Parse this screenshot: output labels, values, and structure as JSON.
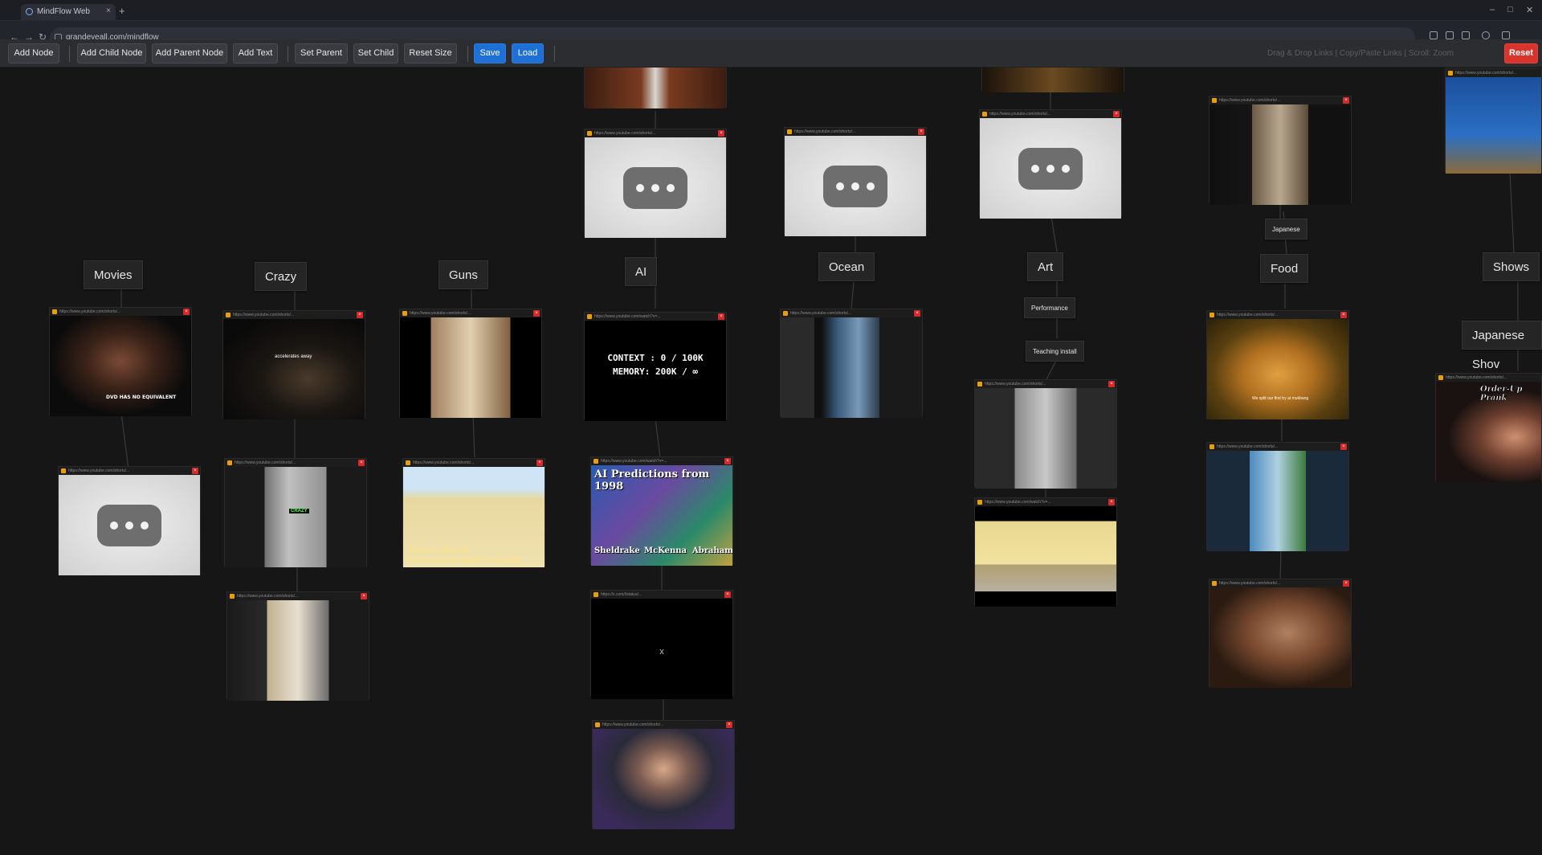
{
  "browser": {
    "tab_title": "MindFlow Web",
    "url": "grandeyeall.com/mindflow"
  },
  "toolbar": {
    "add_node": "Add Node",
    "add_child_node": "Add Child Node",
    "add_parent_node": "Add Parent Node",
    "add_text": "Add Text",
    "set_parent": "Set Parent",
    "set_child": "Set Child",
    "reset_size": "Reset Size",
    "save": "Save",
    "load": "Load",
    "reset": "Reset",
    "hint": "Drag & Drop Links | Copy/Paste Links | Scroll: Zoom"
  },
  "labels": {
    "movies": "Movies",
    "crazy": "Crazy",
    "guns": "Guns",
    "ai": "AI",
    "ocean": "Ocean",
    "art": "Art",
    "performance": "Performance",
    "teaching_install": "Teaching install",
    "food": "Food",
    "japanese": "Japanese",
    "shows": "Shows",
    "japanese_shows": "Japanese Shov"
  },
  "cards": {
    "ai_context": "CONTEXT : 0 / 100K",
    "ai_memory": "MEMORY: 200K / ∞",
    "ai_predictions_title": "AI Predictions from 1998",
    "names": [
      "Sheldrake",
      "McKenna",
      "Abraham"
    ],
    "guns_caption_1": "Titta en gång till",
    "guns_caption_2": "Vi ser att han skjuter två skott...",
    "shows_caption": "Order-Up Prank",
    "crazy_sticker": "CRAZY",
    "crazy_caption": "accelerates away",
    "movies_caption": "DVD HAS NO EQUIVALENT",
    "food_caption": "We split our first try at mukbang",
    "x_text": "x",
    "url_short": "https://www.youtube.com/shorts/...",
    "url_watch": "https://www.youtube.com/watch?v=...",
    "url_x": "https://x.com/i/status/..."
  },
  "colors": {
    "save_blue": "#1e6fd6",
    "reset_red": "#d9342b",
    "canvas_bg": "#161616"
  }
}
